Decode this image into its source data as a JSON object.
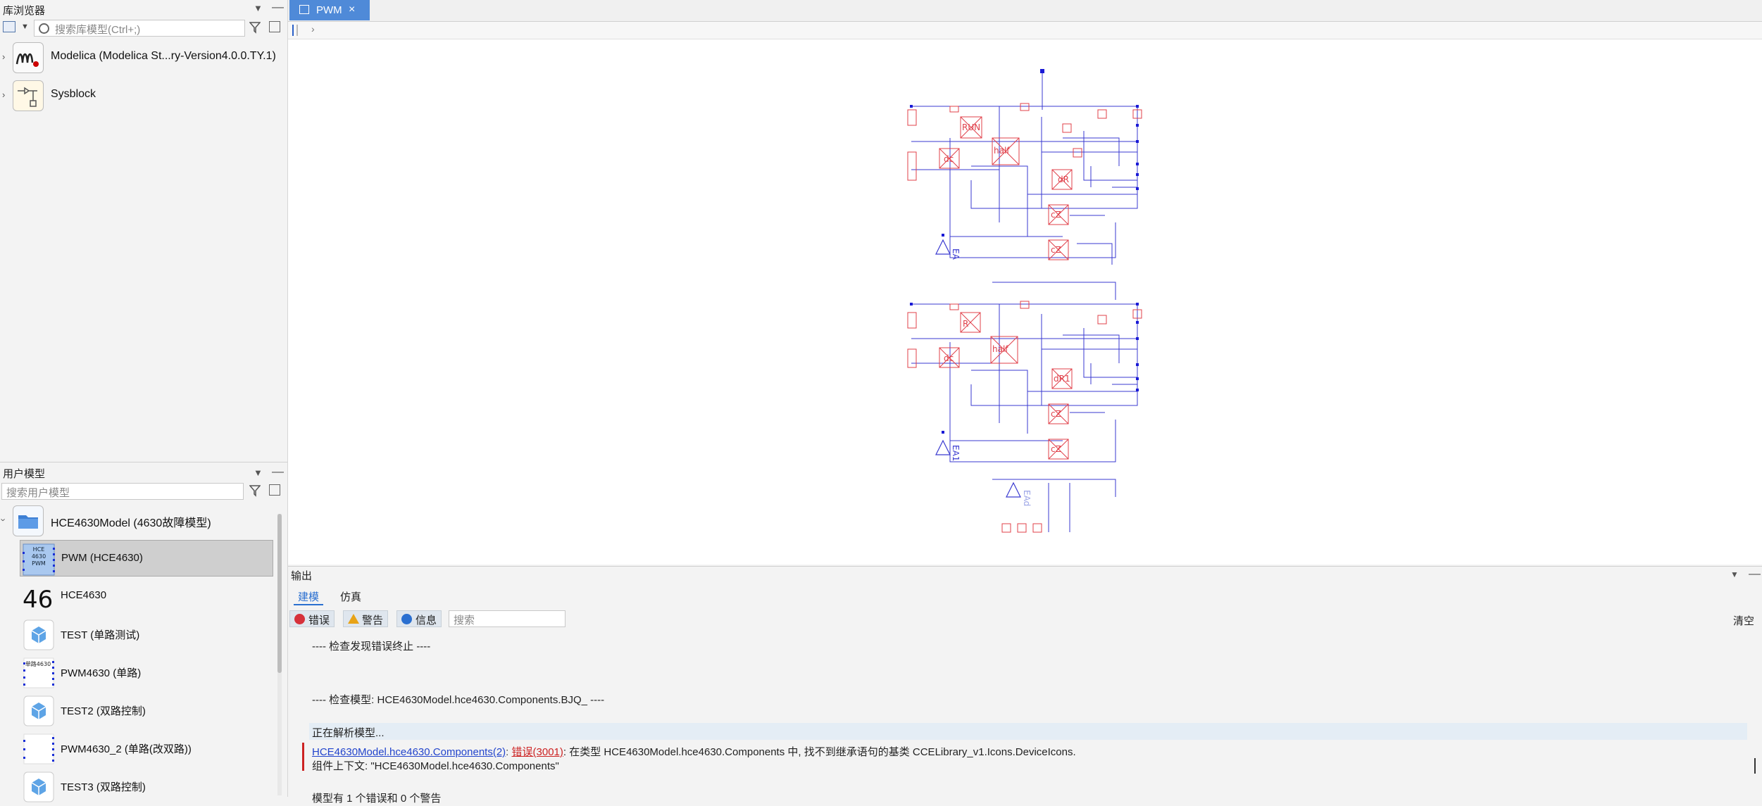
{
  "library_panel": {
    "title": "库浏览器",
    "search_placeholder": "搜索库模型(Ctrl+;)",
    "items": [
      {
        "label": "Modelica (Modelica St...ry-Version4.0.0.TY.1)"
      },
      {
        "label": "Sysblock"
      }
    ]
  },
  "user_panel": {
    "title": "用户模型",
    "search_placeholder": "搜索用户模型",
    "root": {
      "label": "HCE4630Model (4630故障模型)"
    },
    "items": [
      {
        "label": "PWM (HCE4630)",
        "icon_text": "HCE\n4630\nPWM",
        "selected": true
      },
      {
        "label": "HCE4630",
        "icon_text": "46"
      },
      {
        "label": "TEST (单路测试)"
      },
      {
        "label": "PWM4630 (单路)",
        "icon_text": "单路4630"
      },
      {
        "label": "TEST2 (双路控制)"
      },
      {
        "label": "PWM4630_2 (单路(改双路))"
      },
      {
        "label": "TEST3 (双路控制)"
      }
    ]
  },
  "tabs": [
    {
      "label": "PWM",
      "close": "×"
    }
  ],
  "output": {
    "title": "输出",
    "tabs": [
      "建模",
      "仿真"
    ],
    "filters": {
      "error": "错误",
      "warning": "警告",
      "info": "信息"
    },
    "search_placeholder": "搜索",
    "clear_label": "清空",
    "lines": {
      "l1": "---- 检查发现错误终止 ----",
      "l2": "---- 检查模型: HCE4630Model.hce4630.Components.BJQ_ ----",
      "l3": "正在解析模型...",
      "err_link": "HCE4630Model.hce4630.Components(2)",
      "err_code": "错误(3001)",
      "err_msg": ": 在类型 HCE4630Model.hce4630.Components 中, 找不到继承语句的基类 CCELibrary_v1.Icons.DeviceIcons.",
      "err_ctx": "组件上下文: \"HCE4630Model.hce4630.Components\"",
      "l4": "模型有 1 个错误和 0 个警告"
    }
  },
  "diagram_labels": [
    "RUN",
    "half",
    "dc",
    "dR",
    "cZ",
    "cZ",
    "EA",
    "R",
    "half",
    "dc",
    "dR1",
    "cZ",
    "cZ",
    "EA1",
    "EAd"
  ],
  "colors": {
    "accent": "#4f8ad8",
    "wire": "#3333cc",
    "component": "#e0404a",
    "error": "#cc2222"
  }
}
